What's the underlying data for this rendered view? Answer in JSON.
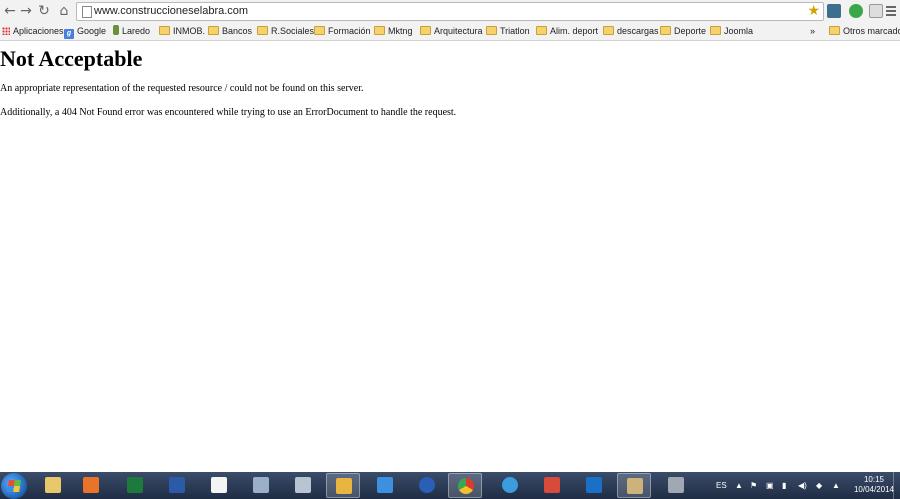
{
  "browser": {
    "url": "www.construccioneselabra.com",
    "bookmarks": [
      {
        "label": "Aplicaciones",
        "icon": "apps-grid-icon"
      },
      {
        "label": "Google",
        "icon": "google-icon"
      },
      {
        "label": "Laredo",
        "icon": "laredo-icon"
      },
      {
        "label": "INMOB.",
        "icon": "folder-icon"
      },
      {
        "label": "Bancos",
        "icon": "folder-icon"
      },
      {
        "label": "R.Sociales",
        "icon": "folder-icon"
      },
      {
        "label": "Formación",
        "icon": "folder-icon"
      },
      {
        "label": "Mktng",
        "icon": "folder-icon"
      },
      {
        "label": "Arquitectura",
        "icon": "folder-icon"
      },
      {
        "label": "Triatlon",
        "icon": "folder-icon"
      },
      {
        "label": "Alim. deport",
        "icon": "folder-icon"
      },
      {
        "label": "descargas",
        "icon": "folder-icon"
      },
      {
        "label": "Deporte",
        "icon": "folder-icon"
      },
      {
        "label": "Joomla",
        "icon": "folder-icon"
      }
    ],
    "overflow_label": "»",
    "other_bookmarks": "Otros marcadores"
  },
  "page": {
    "title": "Not Acceptable",
    "message1": "An appropriate representation of the requested resource / could not be found on this server.",
    "message2": "Additionally, a 404 Not Found error was encountered while trying to use an ErrorDocument to handle the request."
  },
  "taskbar": {
    "language": "ES",
    "time": "10:15",
    "date": "10/04/2014"
  }
}
